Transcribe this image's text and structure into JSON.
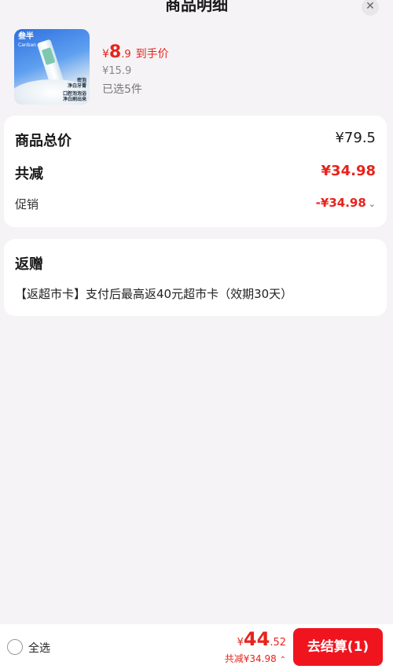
{
  "header": {
    "title": "商品明细",
    "close_icon": "close-icon"
  },
  "product": {
    "image_brand": "叁半",
    "image_brand_en": "Canban",
    "image_tag_1": "密泡\n净白牙膏",
    "image_tag_2": "口腔泡泡浴\n净白刷出来",
    "price_yen": "¥",
    "price_int": "8",
    "price_dec": ".9",
    "price_tip": "到手价",
    "original_price": "¥15.9",
    "selected_count": "已选5件"
  },
  "summary": {
    "total_label": "商品总价",
    "total_value": "¥79.5",
    "reduce_label": "共减",
    "reduce_value": "¥34.98",
    "promo_label": "促销",
    "promo_value": "-¥34.98",
    "promo_chevron": "chevron-down-icon"
  },
  "gift": {
    "title": "返赠",
    "text": "【返超市卡】支付后最高返40元超市卡（效期30天）"
  },
  "footer": {
    "select_all": "全选",
    "price_yen": "¥",
    "price_int": "44",
    "price_dec": ".52",
    "saved": "共减¥34.98",
    "checkout_label": "去结算(1)"
  },
  "colors": {
    "accent": "#e8231c",
    "checkout_bg": "#f0141e",
    "background": "#f5f3f5"
  }
}
